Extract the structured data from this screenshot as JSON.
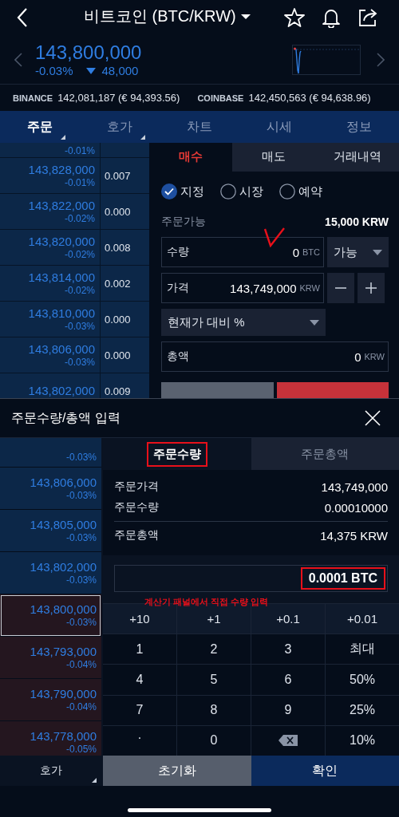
{
  "header": {
    "title": "비트코인 (BTC/KRW)"
  },
  "ticker": {
    "price": "143,800,000",
    "change_rate": "-0.03%",
    "change": "48,000",
    "falling": true
  },
  "exchanges": [
    {
      "name": "BINANCE",
      "value": "142,081,187 (€ 94,393.56)"
    },
    {
      "name": "COINBASE",
      "value": "142,450,563 (€ 94,638.96)"
    }
  ],
  "tabs": [
    {
      "label": "주문",
      "selected": true,
      "corner": true
    },
    {
      "label": "호가",
      "selected": false,
      "corner": true
    },
    {
      "label": "차트",
      "selected": false,
      "corner": false
    },
    {
      "label": "시세",
      "selected": false,
      "corner": false
    },
    {
      "label": "정보",
      "selected": false,
      "corner": false
    }
  ],
  "order_book": [
    {
      "rate": "-0.01%"
    },
    {
      "price": "143,828,000",
      "rate": "-0.01%",
      "qty": "0.007"
    },
    {
      "price": "143,822,000",
      "rate": "-0.02%",
      "qty": "0.000"
    },
    {
      "price": "143,820,000",
      "rate": "-0.02%",
      "qty": "0.008"
    },
    {
      "price": "143,814,000",
      "rate": "-0.02%",
      "qty": "0.002"
    },
    {
      "price": "143,810,000",
      "rate": "-0.03%",
      "qty": "0.000"
    },
    {
      "price": "143,806,000",
      "rate": "-0.03%",
      "qty": "0.000"
    },
    {
      "price": "143,802,000",
      "qty": "0.009"
    }
  ],
  "order_panel": {
    "tabs": [
      {
        "label": "매수",
        "selected": true
      },
      {
        "label": "매도",
        "selected": false
      },
      {
        "label": "거래내역",
        "selected": false
      }
    ],
    "order_types": [
      {
        "label": "지정",
        "selected": true
      },
      {
        "label": "시장",
        "selected": false
      },
      {
        "label": "예약",
        "selected": false
      }
    ],
    "available": {
      "label": "주문가능",
      "value": "15,000 KRW"
    },
    "quantity": {
      "label": "수량",
      "value": "0",
      "unit": "BTC",
      "marked": true
    },
    "quantity_mode": "가능",
    "price": {
      "label": "가격",
      "value": "143,749,000",
      "unit": "KRW"
    },
    "ratio_select": "현재가 대비 %",
    "total": {
      "label": "총액",
      "value": "0",
      "unit": "KRW"
    }
  },
  "sheet": {
    "title": "주문수량/총액 입력",
    "order_book": [
      {
        "rate": "-0.03%",
        "bid": false,
        "selected": false
      },
      {
        "price": "143,806,000",
        "rate": "-0.03%",
        "bid": false,
        "selected": false
      },
      {
        "price": "143,805,000",
        "rate": "-0.03%",
        "bid": false,
        "selected": false
      },
      {
        "price": "143,802,000",
        "rate": "-0.03%",
        "bid": false,
        "selected": false
      },
      {
        "price": "143,800,000",
        "rate": "-0.03%",
        "bid": true,
        "selected": true
      },
      {
        "price": "143,793,000",
        "rate": "-0.04%",
        "bid": true,
        "selected": false
      },
      {
        "price": "143,790,000",
        "rate": "-0.04%",
        "bid": true,
        "selected": false
      },
      {
        "price": "143,778,000",
        "rate": "-0.05%",
        "bid": true,
        "selected": false
      }
    ],
    "book_tab": "호가",
    "tabs": [
      {
        "label": "주문수량",
        "selected": true,
        "boxed": true
      },
      {
        "label": "주문총액",
        "selected": false,
        "boxed": false
      }
    ],
    "summary": [
      {
        "label": "주문가격",
        "value": "143,749,000"
      },
      {
        "label": "주문수량",
        "value": "0.00010000"
      },
      {
        "label": "주문총액",
        "value": "14,375 KRW"
      }
    ],
    "input": {
      "value": "0.0001 BTC",
      "boxed": true
    },
    "note": "계산기 패널에서 직접 수량 입력",
    "keypad": [
      {
        "kind": "step",
        "label": "+10"
      },
      {
        "kind": "step",
        "label": "+1"
      },
      {
        "kind": "step",
        "label": "+0.1"
      },
      {
        "kind": "step",
        "label": "+0.01"
      },
      {
        "kind": "key",
        "label": "1"
      },
      {
        "kind": "key",
        "label": "2"
      },
      {
        "kind": "key",
        "label": "3"
      },
      {
        "kind": "key",
        "label": "최대"
      },
      {
        "kind": "key",
        "label": "4"
      },
      {
        "kind": "key",
        "label": "5"
      },
      {
        "kind": "key",
        "label": "6"
      },
      {
        "kind": "key",
        "label": "50%"
      },
      {
        "kind": "key",
        "label": "7"
      },
      {
        "kind": "key",
        "label": "8"
      },
      {
        "kind": "key",
        "label": "9"
      },
      {
        "kind": "key",
        "label": "25%"
      },
      {
        "kind": "dot",
        "label": "."
      },
      {
        "kind": "key",
        "label": "0"
      },
      {
        "kind": "backspace"
      },
      {
        "kind": "key",
        "label": "10%"
      }
    ],
    "buttons": [
      {
        "label": "초기화",
        "kind": "reset"
      },
      {
        "label": "확인",
        "kind": "confirm"
      }
    ]
  }
}
